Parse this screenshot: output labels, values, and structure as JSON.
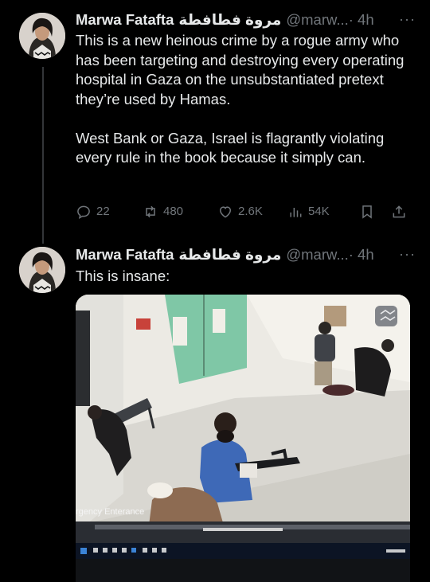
{
  "tweets": [
    {
      "author_name": "Marwa Fatafta",
      "author_name_arabic": "مروة فطافطة",
      "handle": "@marw...",
      "time": "· 4h",
      "more_icon": "more-icon",
      "text": "This is a new heinous crime by a rogue army who has been targeting and destroying every operating hospital in Gaza on the unsubstantiated pretext they’re used by Hamas.\n\nWest Bank or Gaza, Israel is flagrantly violating every rule in the book because it simply can.",
      "actions": {
        "replies": "22",
        "reposts": "480",
        "likes": "2.6K",
        "views": "54K"
      }
    },
    {
      "author_name": "Marwa Fatafta",
      "author_name_arabic": "مروة فطافطة",
      "handle": "@marw...",
      "time": "· 4h",
      "more_icon": "more-icon",
      "text": "This is insane:",
      "media": {
        "sign_text": "rgency Enterance"
      }
    }
  ],
  "colors": {
    "background": "#000000",
    "text": "#e7e9ea",
    "secondary": "#71767b",
    "thread_line": "#333639"
  }
}
